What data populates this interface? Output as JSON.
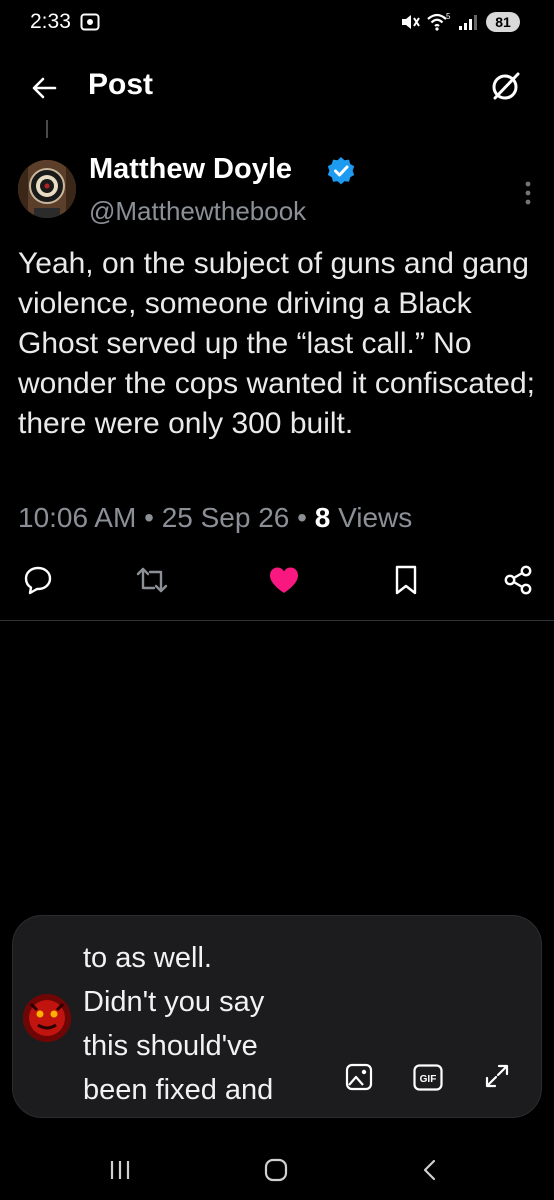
{
  "status_bar": {
    "time": "2:33",
    "battery": "81",
    "signal_label": "5",
    "icons": [
      "screenshot-icon",
      "mute-icon",
      "wifi-icon",
      "signal-icon",
      "battery-icon"
    ]
  },
  "header": {
    "title": "Post",
    "back_icon": "arrow-left-icon",
    "grok_icon": "grok-icon"
  },
  "post": {
    "author_name": "Matthew Doyle",
    "verified": true,
    "handle": "@Matthewthebook",
    "text": "Yeah, on the subject of guns and gang violence, someone driving a Black Ghost served up the “last call.” No wonder the cops wanted it confiscated; there were only 300 built.",
    "time": "10:06 AM",
    "date": "25 Sep 26",
    "separator": "•",
    "views_count": "8",
    "views_label": "Views"
  },
  "actions": [
    {
      "name": "reply",
      "icon": "reply-icon"
    },
    {
      "name": "repost",
      "icon": "repost-icon"
    },
    {
      "name": "like",
      "icon": "heart-icon",
      "active": true
    },
    {
      "name": "bookmark",
      "icon": "bookmark-icon"
    },
    {
      "name": "share",
      "icon": "share-icon"
    }
  ],
  "composer": {
    "line1": "to as well.",
    "line2": "Didn't you say",
    "line3": "this should've",
    "line4": "been fixed and",
    "gif_label": "GIF"
  },
  "nav": [
    "recents-button",
    "home-button",
    "back-button"
  ],
  "colors": {
    "background": "#000000",
    "text": "#e7e9ea",
    "secondary_text": "#8b9096",
    "verified_blue": "#1d9bf0",
    "like_pink": "#f91880",
    "composer_bg": "#1c1c1e"
  }
}
